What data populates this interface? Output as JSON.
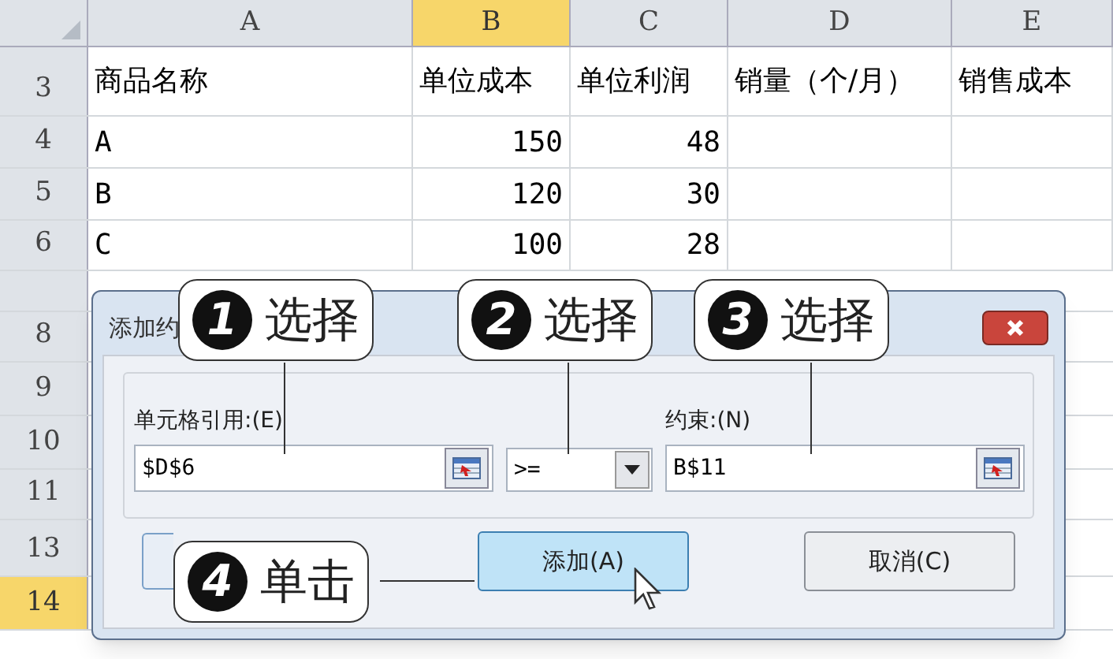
{
  "columns": [
    {
      "label": "A",
      "selected": false
    },
    {
      "label": "B",
      "selected": true
    },
    {
      "label": "C",
      "selected": false
    },
    {
      "label": "D",
      "selected": false
    },
    {
      "label": "E",
      "selected": false
    }
  ],
  "rows": [
    {
      "number": "3",
      "cells": [
        "商品名称",
        "单位成本",
        "单位利润",
        "销量（个/月）",
        "销售成本"
      ]
    },
    {
      "number": "4",
      "cells": [
        "A",
        "150",
        "48",
        "",
        ""
      ]
    },
    {
      "number": "5",
      "cells": [
        "B",
        "120",
        "30",
        "",
        ""
      ]
    },
    {
      "number": "6",
      "cells": [
        "C",
        "100",
        "28",
        "",
        ""
      ]
    }
  ],
  "lower_rows": [
    {
      "number": "8",
      "selected": false
    },
    {
      "number": "9",
      "selected": false
    },
    {
      "number": "10",
      "selected": false
    },
    {
      "number": "11",
      "selected": false
    },
    {
      "number": "13",
      "selected": false
    },
    {
      "number": "14",
      "selected": true
    }
  ],
  "dialog": {
    "title": "添加约",
    "cell_reference": {
      "label": "单元格引用:(E)",
      "value": "$D$6"
    },
    "operator": {
      "value": ">="
    },
    "constraint": {
      "label": "约束:(N)",
      "value": "B$11"
    },
    "buttons": [
      {
        "label": "添加(A)",
        "selected": true
      },
      {
        "label": "取消(C)",
        "selected": false
      }
    ]
  },
  "callouts": [
    {
      "number": "1",
      "text": "选择"
    },
    {
      "number": "2",
      "text": "选择"
    },
    {
      "number": "3",
      "text": "选择"
    },
    {
      "number": "4",
      "text": "单击"
    }
  ]
}
